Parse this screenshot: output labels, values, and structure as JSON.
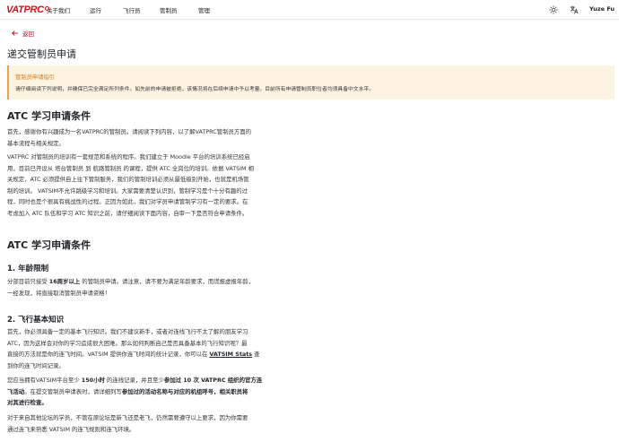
{
  "header": {
    "logo": "VATPRC",
    "nav": [
      "关于我们",
      "运行",
      "飞行员",
      "管制员",
      "管理"
    ],
    "user": "Yuze Fu"
  },
  "back_label": "返回",
  "page_title": "递交管制员申请",
  "notice": {
    "title": "管制员申请指引",
    "body": "请仔细阅读下列说明，并确保已完全满足所列条件。如先前的申请被拒绝，该情况将在后续申请中予以考量。目前所有申请管制员职位者均须具备中文水平。"
  },
  "section1": {
    "heading": "ATC 学习申请条件",
    "p1_lines": [
      "首先，感谢你有兴趣成为一名VATPRC的管制员。请阅读下列内容，以了解VATPRC管制员方面的",
      "基本流程与相关规定。"
    ],
    "p2_lines": [
      "VATPRC 对管制员的培训有一套规范和系统的程序。我们建立于 Moodle 平台的培训系统已经启",
      "用，目前已开设从 塔台管制员 到 航路管制员 的课程，提供 ATC 全岗位的培训。依据 VATSIM 相",
      "关规定，ATC 必须提供自上往下管制服务，我们的管制培训必须从最低级别开始，也就是机场管",
      "制的培训。 VATSIM不允许跳级学习和培训。大家需要清楚认识到，管制学习是个十分有趣的过",
      "程，同时也是个很具有挑战性的过程。正因为如此，我们对学员申请管制学习有一定的要求。在",
      "考虑加入 ATC 队伍和学习 ATC 知识之前，请仔细阅读下面内容，自审一下是否符合申请条件。"
    ]
  },
  "section2": {
    "heading": "ATC 学习申请条件",
    "age": {
      "heading": "1. 年龄限制",
      "l1_a": "分部目前只接受 ",
      "l1_b": "16周岁以上",
      "l1_c": " 的管制员申请。请注意，请不要为满足年龄要求，而谎报虚报年龄，",
      "l2": "一经发现，将直接取消管制员申请资格！"
    },
    "knowledge": {
      "heading": "2. 飞行基本知识",
      "p1_lines": [
        "首先，你必须具备一定的基本飞行知识。我们不建议新手，或者对连线飞行不太了解的朋友学习",
        "ATC，因为这样会对你的学习造成很大困难。那么如何判断自己是否具备基本的飞行知识呢？最"
      ],
      "p1_l3_a": "直接的方法就是你的连飞时间。VATSIM 提供你连飞时间的统计记录，你可以在 ",
      "p1_link": "VATSIM Stats",
      "p1_l3_b": " 查",
      "p1_l4": "到你的连飞时间记录。",
      "p2_l1_a": "您应当拥有VATSIM平台至少 ",
      "p2_l1_b": "150小时",
      "p2_l1_c": " 的连线记录，并且至少",
      "p2_l1_d": "参加过 10 次 VATPRC 组织的官方连",
      "p2_l2_a": "飞活动",
      "p2_l2_b": "。在提交管制员申请表时，请详细列写",
      "p2_l2_c": "参加过的活动名称与对应的机组呼号，相关职员将",
      "p2_l3": "对其进行检查。",
      "p3_lines": [
        "对于来自其他论坛的学员，不管在原论坛是新飞还是老飞，仍然需要遵守以上要求，因为你需要",
        "通过连飞来熟悉 VATSIM 的连飞规则和连飞环境。"
      ]
    }
  }
}
